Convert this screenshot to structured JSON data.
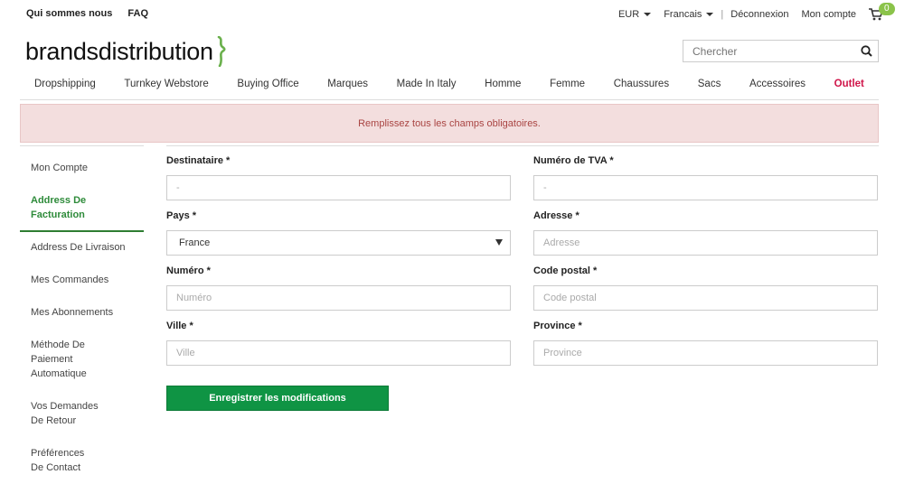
{
  "topbar": {
    "links": [
      "Qui sommes nous",
      "FAQ"
    ],
    "currency": "EUR",
    "language": "Francais",
    "separator": "|",
    "logout": "Déconnexion",
    "account": "Mon compte",
    "cart_count": "0"
  },
  "logo": {
    "text": "brandsdistribution",
    "accent_color": "#6ab04c"
  },
  "search": {
    "placeholder": "Chercher"
  },
  "nav": {
    "items": [
      "Dropshipping",
      "Turnkey Webstore",
      "Buying Office",
      "Marques",
      "Made In Italy",
      "Homme",
      "Femme",
      "Chaussures",
      "Sacs",
      "Accessoires",
      "Outlet"
    ]
  },
  "alert": {
    "message": "Remplissez tous les champs obligatoires."
  },
  "sidebar": {
    "items": [
      "Mon Compte",
      "Address De Facturation",
      "Address De Livraison",
      "Mes Commandes",
      "Mes Abonnements",
      "Méthode De Paiement Automatique",
      "Vos Demandes De Retour",
      "Préférences De Contact"
    ]
  },
  "form": {
    "destinataire": {
      "label": "Destinataire *",
      "value": "-"
    },
    "tva": {
      "label": "Numéro de TVA *",
      "value": "-"
    },
    "pays": {
      "label": "Pays *",
      "value": "France"
    },
    "adresse": {
      "label": "Adresse *",
      "placeholder": "Adresse"
    },
    "numero": {
      "label": "Numéro *",
      "placeholder": "Numéro"
    },
    "code_postal": {
      "label": "Code postal *",
      "placeholder": "Code postal"
    },
    "ville": {
      "label": "Ville *",
      "placeholder": "Ville"
    },
    "province": {
      "label": "Province *",
      "placeholder": "Province"
    },
    "save_label": "Enregistrer les modifications"
  },
  "colors": {
    "primary_green": "#0f9444",
    "outlet_red": "#d0164a",
    "alert_bg": "#f3dede",
    "alert_text": "#a94442"
  }
}
